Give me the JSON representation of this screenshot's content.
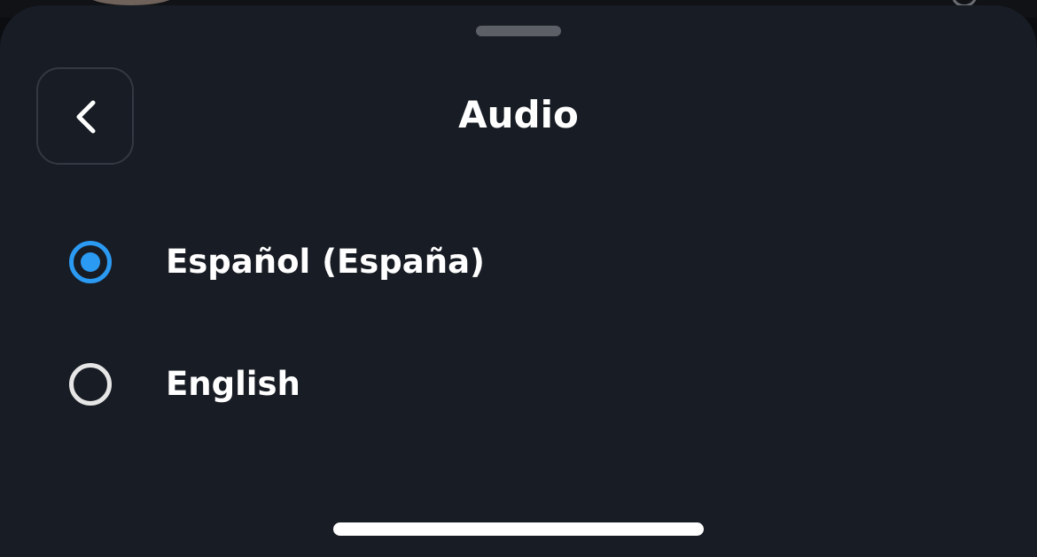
{
  "sheet": {
    "title": "Audio",
    "back_icon": "chevron-left-icon"
  },
  "options": [
    {
      "label": "Español (España)",
      "selected": true
    },
    {
      "label": "English",
      "selected": false
    }
  ],
  "colors": {
    "sheet_background": "#181c24",
    "accent": "#2b9af3",
    "text": "#ffffff"
  }
}
